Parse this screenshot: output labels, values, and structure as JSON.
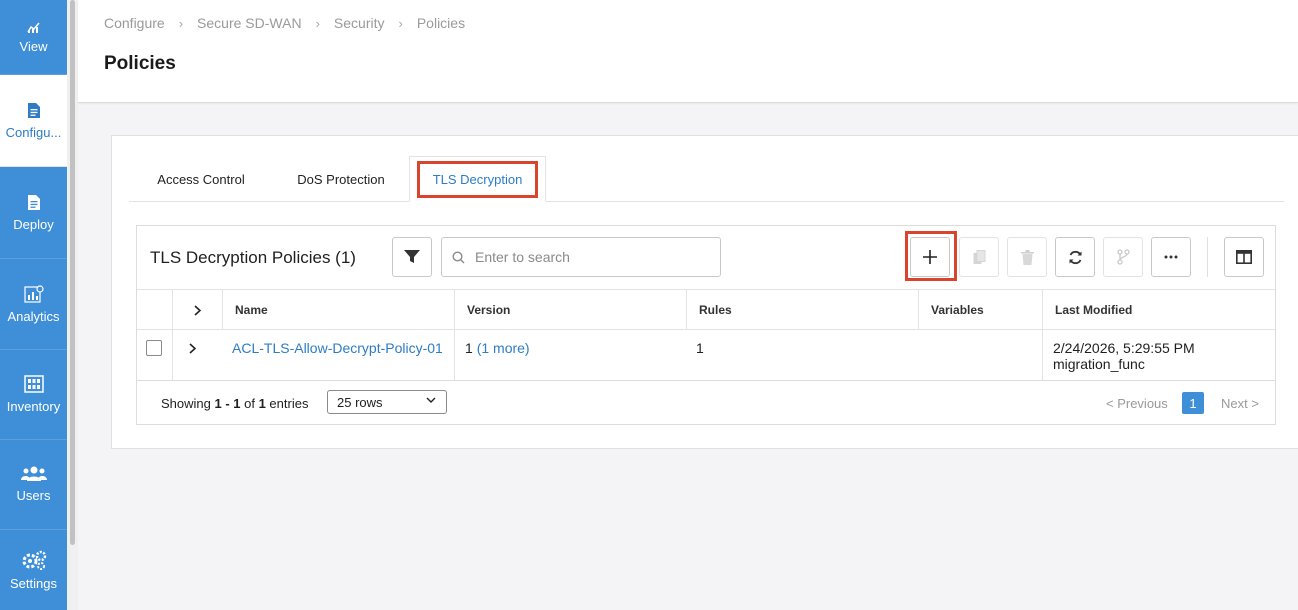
{
  "sidebar": {
    "items": [
      {
        "label": "View",
        "icon": "chart-icon"
      },
      {
        "label": "Configu...",
        "icon": "document-icon",
        "active": true
      },
      {
        "label": "Deploy",
        "icon": "file-icon"
      },
      {
        "label": "Analytics",
        "icon": "analytics-icon"
      },
      {
        "label": "Inventory",
        "icon": "inventory-icon"
      },
      {
        "label": "Users",
        "icon": "users-icon"
      },
      {
        "label": "Settings",
        "icon": "gear-icon"
      }
    ]
  },
  "breadcrumb": [
    "Configure",
    "Secure SD-WAN",
    "Security",
    "Policies"
  ],
  "page_title": "Policies",
  "tabs": [
    {
      "label": "Access Control"
    },
    {
      "label": "DoS Protection"
    },
    {
      "label": "TLS Decryption",
      "active": true
    }
  ],
  "panel": {
    "title": "TLS Decryption Policies (1)",
    "search_placeholder": "Enter to search"
  },
  "table": {
    "columns": [
      "Name",
      "Version",
      "Rules",
      "Variables",
      "Last Modified"
    ],
    "rows": [
      {
        "name": "ACL-TLS-Allow-Decrypt-Policy-01",
        "version": "1",
        "version_more": "(1 more)",
        "rules": "1",
        "variables": "",
        "last_modified": "2/24/2026, 5:29:55 PM",
        "modified_by": "migration_func"
      }
    ]
  },
  "footer": {
    "showing_prefix": "Showing ",
    "range": "1 - 1",
    "of": " of ",
    "total": "1",
    "suffix": " entries",
    "rows_select": "25 rows",
    "prev": "< Previous",
    "page": "1",
    "next": "Next >"
  },
  "colors": {
    "accent": "#3f8fd8",
    "link": "#2d7cc4",
    "highlight": "#d9442f"
  }
}
